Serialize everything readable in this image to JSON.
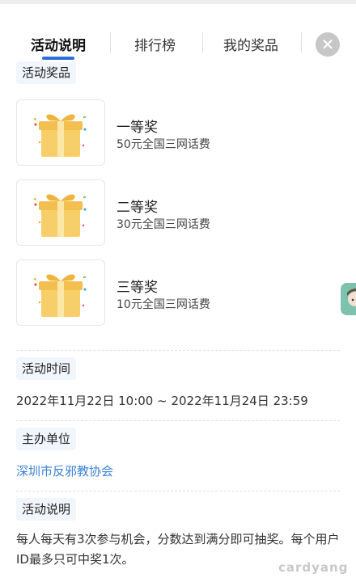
{
  "tabs": [
    {
      "label": "活动说明",
      "active": true
    },
    {
      "label": "排行榜",
      "active": false
    },
    {
      "label": "我的奖品",
      "active": false
    }
  ],
  "close_icon": "close-icon",
  "prizes_section": {
    "title": "活动奖品",
    "items": [
      {
        "title": "一等奖",
        "desc": "50元全国三网话费",
        "icon": "gift-box-icon"
      },
      {
        "title": "二等奖",
        "desc": "30元全国三网话费",
        "icon": "gift-box-icon"
      },
      {
        "title": "三等奖",
        "desc": "10元全国三网话费",
        "icon": "gift-box-icon"
      }
    ]
  },
  "time_section": {
    "title": "活动时间",
    "value": "2022年11月22日 10:00 ~ 2022年11月24日 23:59"
  },
  "host_section": {
    "title": "主办单位",
    "value": "深圳市反邪教协会"
  },
  "rules_section": {
    "title": "活动说明",
    "value": "每人每天有3次参与机会，分数达到满分即可抽奖。每个用户ID最多只可中奖1次。"
  },
  "watermark": "cardyang",
  "colors": {
    "accent": "#2d6fd9",
    "link": "#3b82d9",
    "section_bg": "#f1f5fc"
  }
}
